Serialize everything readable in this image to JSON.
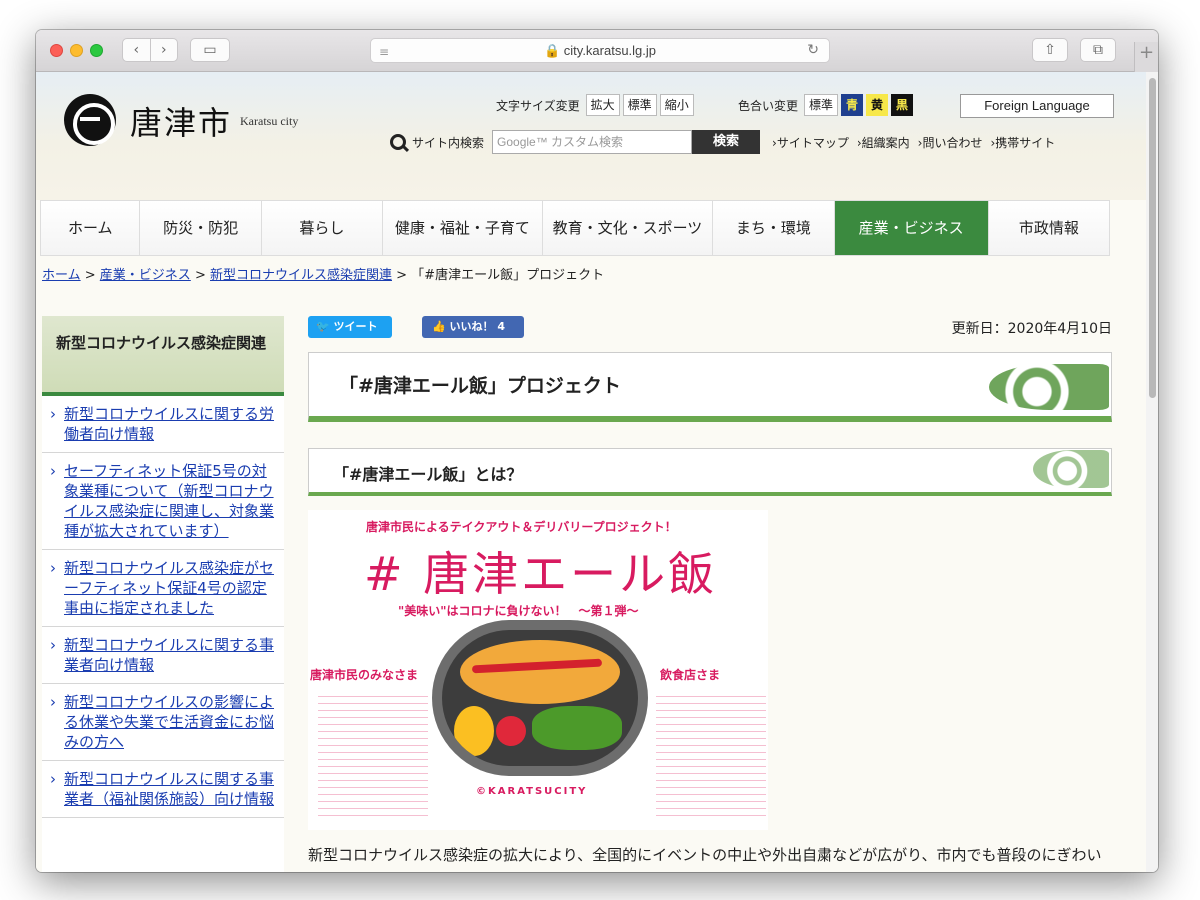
{
  "browser": {
    "url": "city.karatsu.lg.jp",
    "back": "‹",
    "forward": "›",
    "plus": "+"
  },
  "header": {
    "logo_text": "唐津市",
    "logo_sub": "Karatsu city",
    "font_size_label": "文字サイズ変更",
    "font_size_buttons": [
      "拡大",
      "標準",
      "縮小"
    ],
    "color_label": "色合い変更",
    "color_buttons": [
      "標準",
      "青",
      "黄",
      "黒"
    ],
    "colors": {
      "blue": "#1f3f8f",
      "yellow": "#f7e84a",
      "black": "#111111",
      "green": "#3b8a3f"
    },
    "foreign_language": "Foreign Language",
    "search_label": "サイト内検索",
    "search_placeholder": "Google™ カスタム検索",
    "search_button": "検索",
    "links": [
      "›サイトマップ",
      "›組織案内",
      "›問い合わせ",
      "›携帯サイト"
    ]
  },
  "gnav": [
    "ホーム",
    "防災・防犯",
    "暮らし",
    "健康・福祉・子育て",
    "教育・文化・スポーツ",
    "まち・環境",
    "産業・ビジネス",
    "市政情報"
  ],
  "breadcrumb": {
    "items": [
      "ホーム",
      "産業・ビジネス",
      "新型コロナウイルス感染症関連"
    ],
    "sep": " > ",
    "current": "「#唐津エール飯」プロジェクト"
  },
  "sidebar": {
    "heading": "新型コロナウイルス感染症関連",
    "items": [
      "新型コロナウイルスに関する労働者向け情報",
      "セーフティネット保証5号の対象業種について（新型コロナウイルス感染症に関連し、対象業種が拡大されています）",
      "新型コロナウイルス感染症がセーフティネット保証4号の認定事由に指定されました",
      "新型コロナウイルスに関する事業者向け情報",
      "新型コロナウイルスの影響による休業や失業で生活資金にお悩みの方へ",
      "新型コロナウイルスに関する事業者（福祉関係施設）向け情報"
    ]
  },
  "main": {
    "tweet": "ツイート",
    "like": "いいね！ 4",
    "updated": "更新日：2020年4月10日",
    "h1": "「#唐津エール飯」プロジェクト",
    "h2": "「#唐津エール飯」とは？",
    "poster": {
      "top": "唐津市民によるテイクアウト＆デリバリープロジェクト！",
      "title": "# 唐津エール飯",
      "sub": "\"美味い\"はコロナに負けない！　～第１弾～",
      "left": "唐津市民のみなさま",
      "right": "飲食店さま",
      "copyright": "©KARATSUCITY"
    },
    "body": "新型コロナウイルス感染症の拡大により、全国的にイベントの中止や外出自粛などが広がり、市内でも普段のにぎわいが失われつつあります。市内の旅館・ホテルを含む飲食を提供する施設でも宿泊や宴会の中止が相次ぎ、苦境に立たされています。"
  }
}
